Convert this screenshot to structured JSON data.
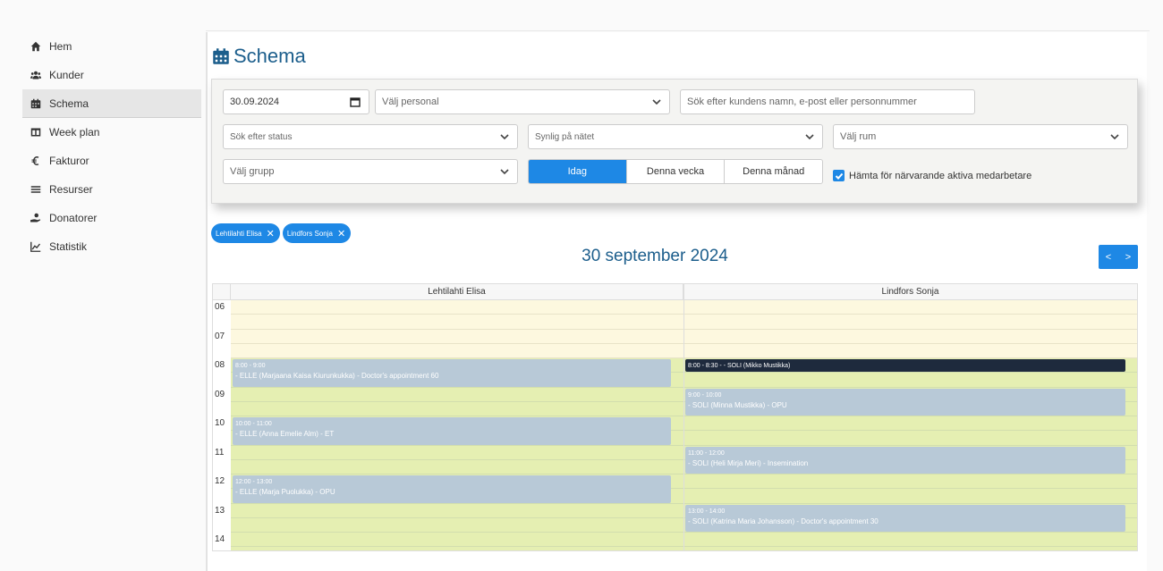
{
  "sidebar": {
    "items": [
      {
        "label": "Hem",
        "icon": "home-icon"
      },
      {
        "label": "Kunder",
        "icon": "users-icon"
      },
      {
        "label": "Schema",
        "icon": "calendar-icon",
        "active": true
      },
      {
        "label": "Week plan",
        "icon": "columns-icon"
      },
      {
        "label": "Fakturor",
        "icon": "euro-icon"
      },
      {
        "label": "Resurser",
        "icon": "bars-icon"
      },
      {
        "label": "Donatorer",
        "icon": "donate-icon"
      },
      {
        "label": "Statistik",
        "icon": "chart-icon"
      }
    ]
  },
  "page": {
    "title": "Schema"
  },
  "filters": {
    "date_value": "30.09.2024",
    "personal_placeholder": "Välj personal",
    "customer_search_placeholder": "Sök efter kundens namn, e-post eller personnummer",
    "status_placeholder": "Sök efter status",
    "visible_placeholder": "Synlig på nätet",
    "room_placeholder": "Välj rum",
    "group_placeholder": "Välj grupp",
    "range_today": "Idag",
    "range_week": "Denna vecka",
    "range_month": "Denna månad",
    "active_staff_label": "Hämta för närvarande aktiva medarbetare",
    "active_staff_checked": true
  },
  "chips": [
    {
      "label": "Lehtilahti Elisa"
    },
    {
      "label": "Lindfors Sonja"
    }
  ],
  "calendar": {
    "date_title": "30 september 2024",
    "prev_label": "<",
    "next_label": ">",
    "columns": [
      "Lehtilahti Elisa",
      "Lindfors Sonja"
    ],
    "hours": [
      "06",
      "07",
      "08",
      "09",
      "10",
      "11",
      "12",
      "13",
      "14"
    ],
    "events": [
      {
        "col": 0,
        "time": "8:00 - 9:00",
        "text": "- ELLE (Marjaana Kaisa Kiurunkukka) - Doctor's appointment 60"
      },
      {
        "col": 0,
        "time": "10:00 - 11:00",
        "text": "- ELLE (Anna Emelie Alm) - ET"
      },
      {
        "col": 0,
        "time": "12:00 - 13:00",
        "text": "- ELLE (Marja Puolukka) - OPU"
      },
      {
        "col": 1,
        "time": "8:00 - 8:30 - - SOLI (Mikko Mustikka)",
        "text": ""
      },
      {
        "col": 1,
        "time": "9:00 - 10:00",
        "text": "- SOLI (Minna Mustikka) - OPU"
      },
      {
        "col": 1,
        "time": "11:00 - 12:00",
        "text": "- SOLI (Heli Mirja Meri) - Insemination"
      },
      {
        "col": 1,
        "time": "13:00 - 14:00",
        "text": "- SOLI (Katrina Maria Johansson) - Doctor's appointment 30"
      }
    ]
  }
}
